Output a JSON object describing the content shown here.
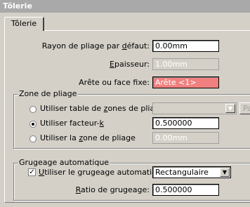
{
  "window": {
    "title": "Tôlerie"
  },
  "tabs": [
    {
      "label": "Tôlerie"
    }
  ],
  "fields": {
    "default_radius": {
      "label_pre": "Rayon de pliage par ",
      "label_u": "d",
      "label_post": "éfaut:",
      "value": "0.00mm"
    },
    "thickness": {
      "label_u": "E",
      "label_post": "paisseur:",
      "value": "1.00mm"
    },
    "fixed_face": {
      "label": "Arête ou face fixe:",
      "value": "Arête <1>"
    }
  },
  "bend_zone": {
    "title": "Zone de pliage",
    "option_table": {
      "label_pre": "Utiliser table de ",
      "label_u": "z",
      "label_post": "ones de pliage",
      "checked": false,
      "value": ""
    },
    "option_k": {
      "label_pre": "Utiliser facteur-",
      "label_u": "k",
      "label_post": "",
      "checked": true,
      "value": "0.500000"
    },
    "option_zone": {
      "label_pre": "Utiliser la ",
      "label_u": "z",
      "label_post": "one de pliage",
      "checked": false,
      "value": "0.00mm"
    },
    "browse_label": "Pa"
  },
  "relief": {
    "title": "Grugeage automatique",
    "use_auto": {
      "label_u": "U",
      "label_post": "tiliser le grugeage automatique",
      "checked": true
    },
    "type": {
      "selected": "Rectangulaire"
    },
    "ratio": {
      "label_u": "R",
      "label_post": "atio de grugeage:",
      "value": "0.500000"
    }
  },
  "icons": {
    "radio_dot": "radio-dot-icon",
    "checkmark": "checkmark-icon",
    "dropdown_arrow": "dropdown-arrow-icon"
  }
}
